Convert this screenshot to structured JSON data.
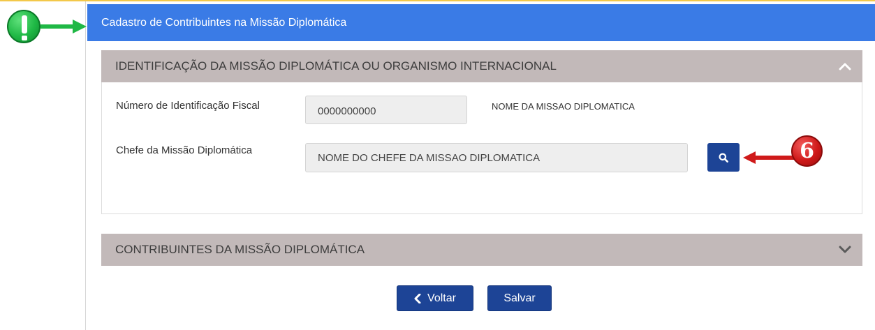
{
  "header": {
    "title": "Cadastro de Contribuintes na Missão Diplomática"
  },
  "annotations": {
    "alert_icon": "exclamation-icon",
    "step_number": "6"
  },
  "panel_identificacao": {
    "title": "IDENTIFICAÇÃO DA MISSÃO DIPLOMÁTICA OU ORGANISMO INTERNACIONAL",
    "state": "expanded",
    "nif_label": "Número de Identificação Fiscal",
    "nif_value": "0000000000",
    "mission_name": "NOME DA MISSAO DIPLOMATICA",
    "chefe_label": "Chefe da Missão Diplomática",
    "chefe_value": "NOME DO CHEFE DA MISSAO DIPLOMATICA",
    "search_icon": "search-icon"
  },
  "panel_contribuintes": {
    "title": "CONTRIBUINTES DA MISSÃO DIPLOMÁTICA",
    "state": "collapsed"
  },
  "actions": {
    "back_label": "Voltar",
    "save_label": "Salvar"
  },
  "colors": {
    "header_bg": "#3a7be6",
    "panel_head_bg": "#c2b9b9",
    "button_bg": "#1d4496",
    "field_bg": "#eeeeee",
    "annotation_green": "#1fb845",
    "annotation_red": "#cf1a1a"
  }
}
